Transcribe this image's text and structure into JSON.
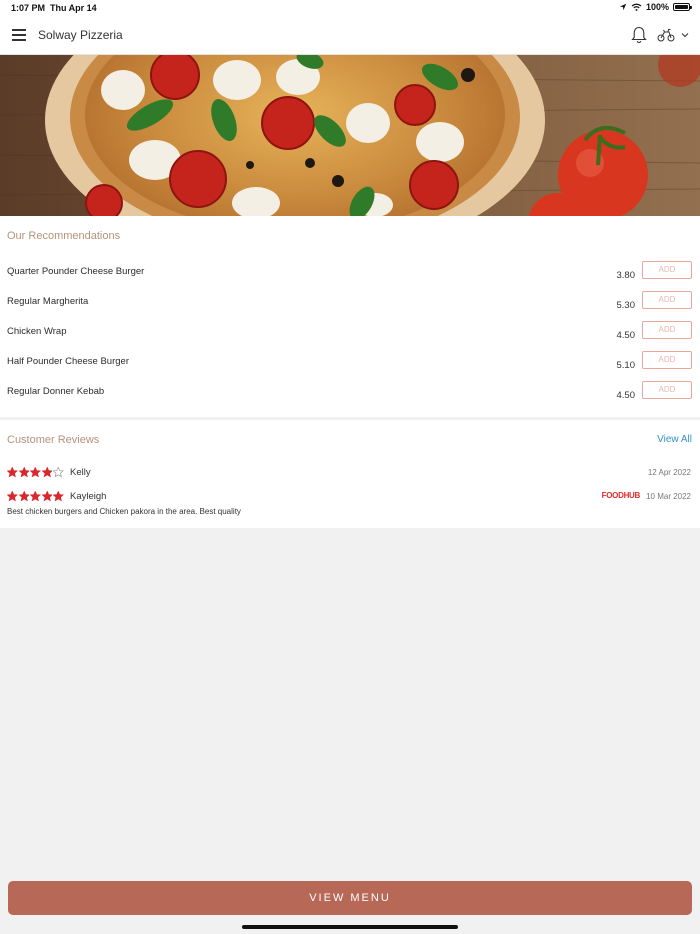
{
  "status_bar": {
    "time": "1:07 PM",
    "date": "Thu Apr 14",
    "battery": "100%",
    "icons": [
      "location-icon",
      "wifi-icon",
      "battery-icon"
    ]
  },
  "nav": {
    "title": "Solway Pizzeria",
    "icons": [
      "menu-icon",
      "bell-icon",
      "delivery-bike-icon",
      "chevron-down-icon"
    ]
  },
  "hero": {
    "image": "pizza-banner"
  },
  "recommendations": {
    "title": "Our Recommendations",
    "add_label": "ADD",
    "items": [
      {
        "name": "Quarter Pounder Cheese Burger",
        "price": "3.80"
      },
      {
        "name": "Regular Margherita",
        "price": "5.30"
      },
      {
        "name": "Chicken Wrap",
        "price": "4.50"
      },
      {
        "name": "Half Pounder Cheese Burger",
        "price": "5.10"
      },
      {
        "name": "Regular Donner Kebab",
        "price": "4.50"
      }
    ]
  },
  "reviews": {
    "title": "Customer Reviews",
    "view_all": "View All",
    "items": [
      {
        "name": "Kelly",
        "rating": 4,
        "date": "12 Apr 2022",
        "source": "",
        "text": ""
      },
      {
        "name": "Kayleigh",
        "rating": 5,
        "date": "10 Mar 2022",
        "source": "FOODHUB",
        "text": "Best chicken burgers and Chicken pakora in the area. Best quality"
      }
    ]
  },
  "footer": {
    "view_menu": "VIEW MENU"
  },
  "colors": {
    "accent": "#b76856",
    "section_title": "#b6927a",
    "add_border": "#e7a89b",
    "link": "#2e93c2",
    "star": "#d8282d",
    "brand_foodhub": "#d82d2d"
  }
}
